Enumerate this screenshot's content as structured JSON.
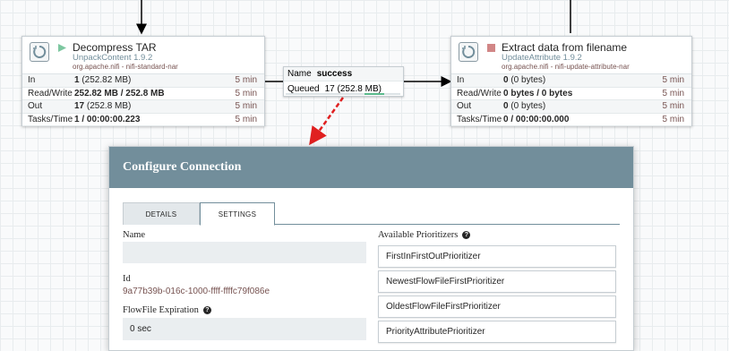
{
  "processor_left": {
    "name": "Decompress TAR",
    "type": "UnpackContent 1.9.2",
    "bundle": "org.apache.nifi - nifi-standard-nar",
    "state_icon": "play-icon",
    "stats": [
      {
        "label": "In",
        "value": "1",
        "sub": " (252.82 MB)",
        "time": "5 min"
      },
      {
        "label": "Read/Write",
        "value": "252.82 MB / 252.8 MB",
        "sub": "",
        "time": "5 min"
      },
      {
        "label": "Out",
        "value": "17",
        "sub": " (252.8 MB)",
        "time": "5 min"
      },
      {
        "label": "Tasks/Time",
        "value": "1 / 00:00:00.223",
        "sub": "",
        "time": "5 min"
      }
    ]
  },
  "processor_right": {
    "name": "Extract data from filename",
    "type": "UpdateAttribute 1.9.2",
    "bundle": "org.apache.nifi - nifi-update-attribute-nar",
    "state_icon": "stop-icon",
    "stats": [
      {
        "label": "In",
        "value": "0",
        "sub": " (0 bytes)",
        "time": "5 min"
      },
      {
        "label": "Read/Write",
        "value": "0 bytes / 0 bytes",
        "sub": "",
        "time": "5 min"
      },
      {
        "label": "Out",
        "value": "0",
        "sub": " (0 bytes)",
        "time": "5 min"
      },
      {
        "label": "Tasks/Time",
        "value": "0 / 00:00:00.000",
        "sub": "",
        "time": "5 min"
      }
    ]
  },
  "connection": {
    "name_label": "Name",
    "name_value": "success",
    "queued_label": "Queued",
    "queued_value": "17",
    "queued_size": " (252.8 MB)"
  },
  "dialog": {
    "title": "Configure Connection",
    "tabs": [
      "DETAILS",
      "SETTINGS"
    ],
    "active_tab": "SETTINGS",
    "name_label": "Name",
    "name_value": "",
    "id_label": "Id",
    "id_value": "9a77b39b-016c-1000-ffff-ffffc79f086e",
    "expiration_label": "FlowFile Expiration",
    "expiration_value": "0 sec",
    "prioritizers_label": "Available Prioritizers",
    "prioritizers": [
      "FirstInFirstOutPrioritizer",
      "NewestFlowFileFirstPrioritizer",
      "OldestFlowFileFirstPrioritizer",
      "PriorityAttributePrioritizer"
    ]
  },
  "colors": {
    "header": "#728e9b",
    "running": "#7dc7a0",
    "stopped": "#d18686",
    "annotation_arrow": "#e02020"
  }
}
